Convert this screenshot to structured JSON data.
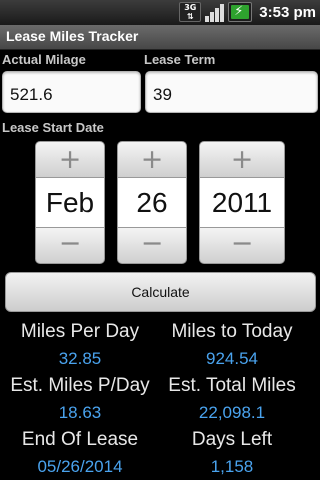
{
  "status_bar": {
    "network": "3G",
    "time": "3:53 pm"
  },
  "app": {
    "title": "Lease Miles Tracker"
  },
  "form": {
    "actual_mileage_label": "Actual Milage",
    "actual_mileage_value": "521.6",
    "lease_term_label": "Lease Term",
    "lease_term_value": "39",
    "start_date_label": "Lease Start Date",
    "month": "Feb",
    "day": "26",
    "year": "2011",
    "increment_symbol": "+",
    "decrement_symbol": "−",
    "calculate_label": "Calculate"
  },
  "stats": {
    "miles_per_day_label": "Miles Per Day",
    "miles_per_day_value": "32.85",
    "miles_to_today_label": "Miles to Today",
    "miles_to_today_value": "924.54",
    "est_miles_per_day_label": "Est. Miles P/Day",
    "est_miles_per_day_value": "18.63",
    "est_total_miles_label": "Est. Total Miles",
    "est_total_miles_value": "22,098.1",
    "end_of_lease_label": "End Of Lease",
    "end_of_lease_value": "05/26/2014",
    "days_left_label": "Days Left",
    "days_left_value": "1,158"
  },
  "colors": {
    "value_accent": "#4aa3ee",
    "background": "#000000",
    "title_bar": "#5a5a5a",
    "battery": "#2ea22e"
  },
  "icons": [
    "3g-icon",
    "signal-icon",
    "battery-charging-icon"
  ]
}
